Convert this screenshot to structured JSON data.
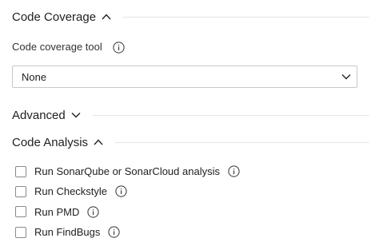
{
  "code_coverage": {
    "title": "Code Coverage",
    "expanded": true,
    "tool_label": "Code coverage tool",
    "tool_value": "None",
    "icons": {
      "toggle": "chevron-up-icon",
      "info": "info-icon",
      "dropdown": "chevron-down-icon"
    }
  },
  "advanced": {
    "title": "Advanced",
    "expanded": false,
    "icons": {
      "toggle": "chevron-down-icon"
    }
  },
  "code_analysis": {
    "title": "Code Analysis",
    "expanded": true,
    "icons": {
      "toggle": "chevron-up-icon",
      "info": "info-icon"
    },
    "options": [
      {
        "label": "Run SonarQube or SonarCloud analysis",
        "checked": false
      },
      {
        "label": "Run Checkstyle",
        "checked": false
      },
      {
        "label": "Run PMD",
        "checked": false
      },
      {
        "label": "Run FindBugs",
        "checked": false
      }
    ]
  },
  "colors": {
    "text": "#212121",
    "border": "#c8c8c8",
    "divider": "#e6e6e6",
    "checkbox_border": "#8a8a8a"
  }
}
